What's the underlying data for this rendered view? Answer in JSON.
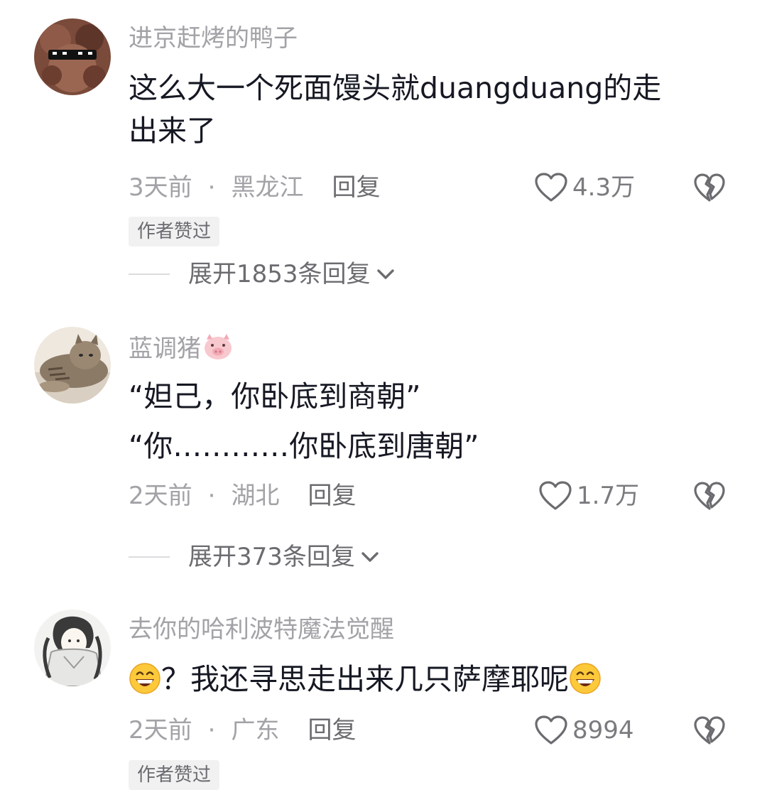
{
  "comments": [
    {
      "username": "进京赶烤的鸭子",
      "text_line1": "这么大一个死面馒头就duangduang的走",
      "text_line2": "出来了",
      "time": "3天前",
      "location": "黑龙江",
      "reply_label": "回复",
      "likes": "4.3万",
      "badge": "作者赞过",
      "expand": "展开1853条回复"
    },
    {
      "username": "蓝调猪",
      "username_icon": "pig-emoji-icon",
      "text_line1": "“妲己，你卧底到商朝”",
      "text_line2": "“你…………你卧底到唐朝”",
      "time": "2天前",
      "location": "湖北",
      "reply_label": "回复",
      "likes": "1.7万",
      "expand": "展开373条回复"
    },
    {
      "username": "去你的哈利波特魔法觉醒",
      "text_prefix_icon": "grin-emoji-icon",
      "text_main": "？我还寻思走出来几只萨摩耶呢",
      "text_suffix_icon": "grin-emoji-icon",
      "time": "2天前",
      "location": "广东",
      "reply_label": "回复",
      "likes": "8994",
      "badge": "作者赞过"
    }
  ],
  "dot": "·"
}
